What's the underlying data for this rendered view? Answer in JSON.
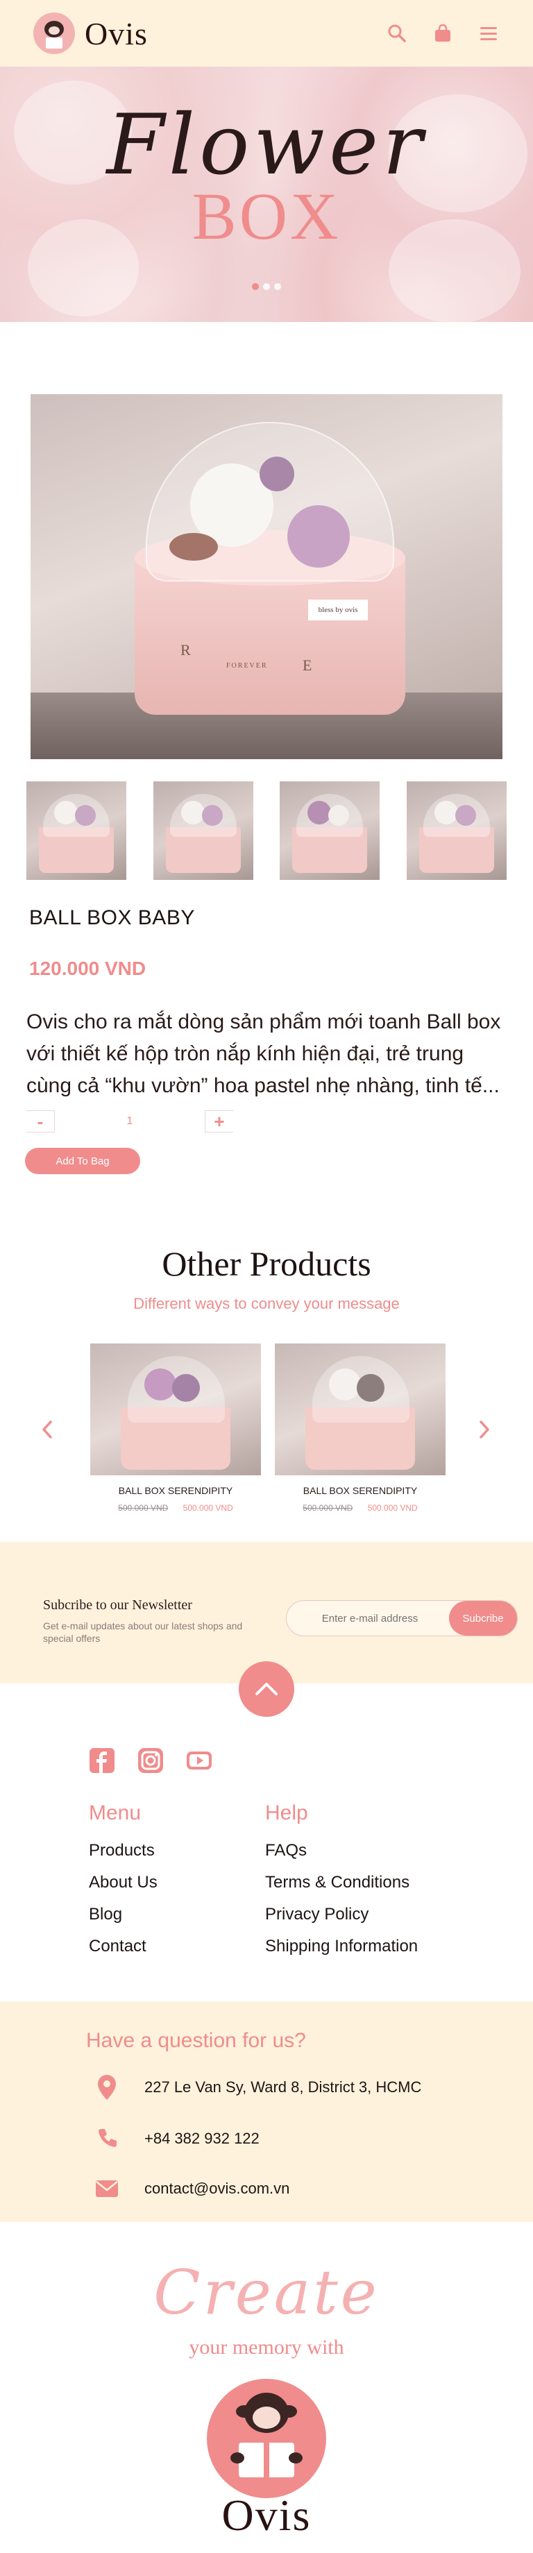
{
  "header": {
    "brand": "Ovis",
    "icons": [
      "search-icon",
      "bag-icon",
      "menu-icon"
    ]
  },
  "hero": {
    "script_text": "Flower",
    "box_text": "BOX",
    "slides_total": 3,
    "active_slide": 1
  },
  "product": {
    "name": "BALL BOX BABY",
    "price": "120.000 VND",
    "description": "Ovis cho ra mắt dòng sản phẩm mới toanh Ball box với thiết kế hộp tròn nắp kính hiện đại, trẻ trung cùng cả “khu vườn” hoa pastel  nhẹ nhàng, tinh tế...",
    "image_tag": "bless by ovis",
    "box_letters": [
      "R",
      "E"
    ],
    "box_word": "FOREVER",
    "quantity_minus": "-",
    "quantity_plus": "+",
    "quantity": "1",
    "add_to_bag": "Add To Bag"
  },
  "other_products": {
    "title": "Other Products",
    "subtitle": "Different ways to convey your message",
    "items": [
      {
        "name": "BALL BOX SERENDIPITY",
        "old_price": "500.000 VND",
        "new_price": "500.000 VND"
      },
      {
        "name": "BALL BOX SERENDIPITY",
        "old_price": "500.000 VND",
        "new_price": "500.000 VND"
      }
    ]
  },
  "newsletter": {
    "title": "Subcribe to our Newsletter",
    "subtitle": "Get e-mail updates about our latest shops and special offers",
    "placeholder": "Enter e-mail address",
    "button": "Subcribe"
  },
  "footer": {
    "socials": [
      "facebook-icon",
      "instagram-icon",
      "youtube-icon"
    ],
    "menu": {
      "heading": "Menu",
      "links": [
        "Products",
        "About Us",
        "Blog",
        "Contact"
      ]
    },
    "help": {
      "heading": "Help",
      "links": [
        "FAQs",
        "Terms & Conditions",
        "Privacy Policy",
        "Shipping Information"
      ]
    }
  },
  "contact": {
    "title": "Have a question for us?",
    "address": "227 Le Van Sy, Ward 8,  District 3, HCMC",
    "phone": "+84 382 932 122",
    "email": "contact@ovis.com.vn"
  },
  "bottom": {
    "script": "Create",
    "tagline": "your memory with",
    "brand": "Ovis"
  },
  "colors": {
    "accent": "#f08c8c",
    "cream": "#fff2dc",
    "dark": "#2a1212"
  }
}
